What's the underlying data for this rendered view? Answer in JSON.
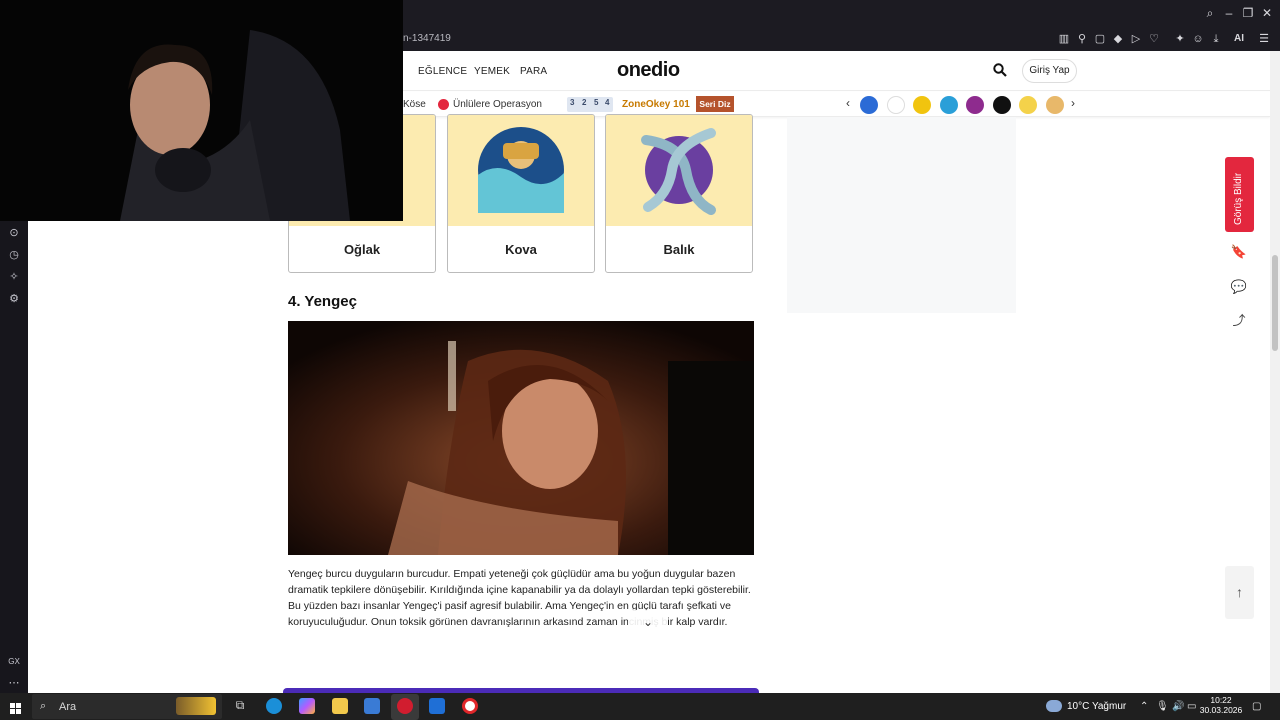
{
  "browser": {
    "url_fragment": "n-1347419",
    "ai_label": "AI",
    "sidebar_gx_label": "GX"
  },
  "site": {
    "nav": [
      "EĞLENCE",
      "YEMEK",
      "PARA"
    ],
    "logo": "onedio",
    "login_label": "Giriş Yap",
    "subbar": {
      "kose": "Köse",
      "unlulere": "Ünlülere Operasyon",
      "game_digits": [
        "3",
        "2",
        "5",
        "4"
      ],
      "zoneokey": "ZoneOkey 101",
      "seri_diz": "Seri Diz"
    }
  },
  "article": {
    "cards": [
      {
        "label": "Oğlak"
      },
      {
        "label": "Kova"
      },
      {
        "label": "Balık"
      }
    ],
    "heading": "4. Yengeç",
    "paragraph": "Yengeç burcu duyguların burcudur. Empati yeteneği çok güçlüdür ama bu yoğun duygular bazen dramatik tepkilere dönüşebilir. Kırıldığında içine kapanabilir ya da dolaylı yollardan tepki gösterebilir. Bu yüzden bazı insanlar Yengeç'i pasif agresif bulabilir. Ama Yengeç'in en güçlü tarafı şefkati ve koruyuculuğudur. Onun toksik görünen davranışlarının arkasınd zaman incinmiş bir kalp vardır."
  },
  "right_rail": {
    "feedback_label": "Görüş Bildir"
  },
  "taskbar": {
    "search_placeholder": "Ara",
    "weather": "10°C  Yağmur",
    "time": "10:22",
    "date": "30.03.2026"
  },
  "colors": {
    "accent_red": "#e3273e",
    "card_bg": "#fcebb0",
    "purple": "#4b2bb8"
  }
}
